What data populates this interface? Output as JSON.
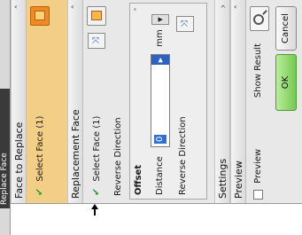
{
  "window": {
    "title_tab": "Replace Face"
  },
  "face_to_replace": {
    "header": "Face to Replace",
    "select_label": "Select Face (1)",
    "check_icon": "check-icon"
  },
  "replacement_face": {
    "header": "Replacement Face",
    "select_label": "Select Face (1)",
    "reverse_direction": "Reverse Direction",
    "offset": {
      "title": "Offset",
      "distance_label": "Distance",
      "distance_value": "0",
      "unit": "mm",
      "reverse_direction": "Reverse Direction"
    }
  },
  "settings": {
    "header": "Settings"
  },
  "preview_group": {
    "header": "Preview",
    "preview_checkbox": "Preview",
    "show_result": "Show Result"
  },
  "buttons": {
    "ok": "OK",
    "cancel": "Cancel"
  },
  "colors": {
    "active_selection": "#f3ce86",
    "ok_button": "#75c852",
    "face_button": "#f08a22",
    "check": "#2d9c2d"
  }
}
